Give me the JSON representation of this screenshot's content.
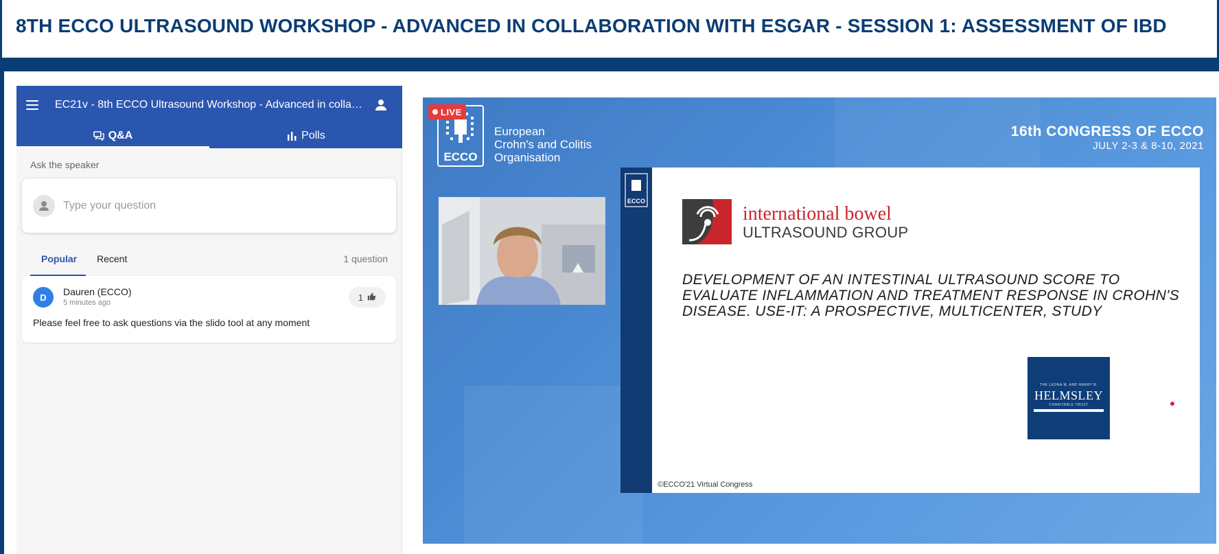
{
  "header": {
    "title": "8TH ECCO ULTRASOUND WORKSHOP - ADVANCED IN COLLABORATION WITH ESGAR - SESSION 1: ASSESSMENT OF IBD"
  },
  "slido": {
    "event_title": "EC21v - 8th ECCO Ultrasound Workshop - Advanced in collabo...",
    "tabs": [
      {
        "label": "Q&A",
        "icon": "chat-bubbles-icon",
        "active": true
      },
      {
        "label": "Polls",
        "icon": "bar-chart-icon",
        "active": false
      }
    ],
    "ask_label": "Ask the speaker",
    "question_input": {
      "placeholder": "Type your question",
      "value": ""
    },
    "sort_tabs": [
      {
        "label": "Popular",
        "active": true
      },
      {
        "label": "Recent",
        "active": false
      }
    ],
    "question_count": "1 question",
    "questions": [
      {
        "avatar_initial": "D",
        "author": "Dauren (ECCO)",
        "time": "5 minutes ago",
        "likes": "1",
        "text": "Please feel free to ask questions via the slido tool at any moment"
      }
    ]
  },
  "video": {
    "live_badge": "LIVE",
    "org_logo_text": "ECCO",
    "org_name": [
      "European",
      "Crohn's and Colitis",
      "Organisation"
    ],
    "congress_title": "16th CONGRESS OF ECCO",
    "congress_date": "JULY 2-3 & 8-10, 2021",
    "slide": {
      "band_logo_text": "ECCO",
      "group_name_line1": "international bowel",
      "group_name_line2": "ULTRASOUND GROUP",
      "title_lines": [
        "DEVELOPMENT OF AN INTESTINAL ULTRASOUND SCORE TO",
        "EVALUATE INFLAMMATION AND TREATMENT RESPONSE IN CROHN'S",
        "DISEASE. USE-IT: A PROSPECTIVE, MULTICENTER, STUDY"
      ],
      "sponsor_small": "THE LEONA M. AND HARRY B.",
      "sponsor_name": "HELMSLEY",
      "sponsor_sub": "CHARITABLE TRUST",
      "footer": "©ECCO'21 Virtual Congress"
    }
  },
  "colors": {
    "header_navy": "#0b3d75",
    "slido_blue": "#2b56b0",
    "live_red": "#e83a3a",
    "brand_red": "#c8262c"
  }
}
